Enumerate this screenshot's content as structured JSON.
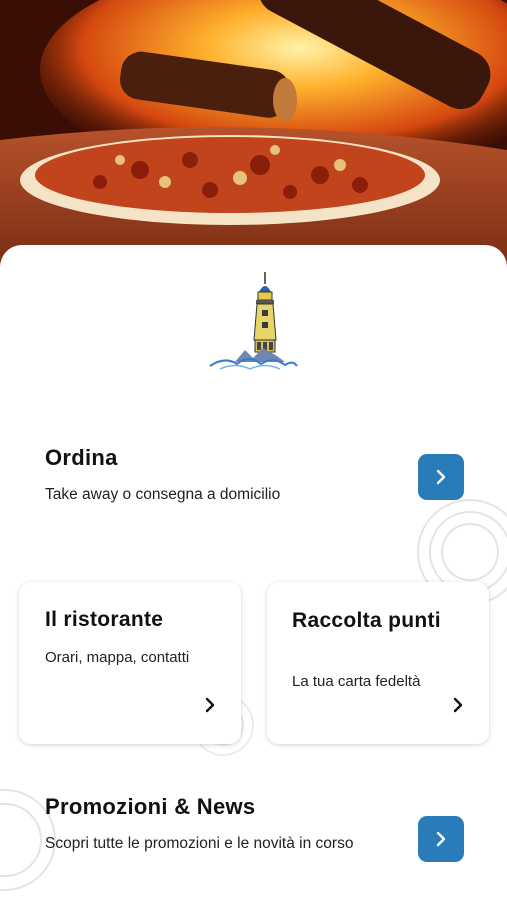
{
  "ordina": {
    "title": "Ordina",
    "subtitle": "Take away o consegna a domicilio"
  },
  "cards": [
    {
      "title": "Il ristorante",
      "subtitle": "Orari, mappa, contatti"
    },
    {
      "title": "Raccolta punti",
      "subtitle": "La tua carta fedeltà"
    }
  ],
  "promo": {
    "title": "Promozioni & News",
    "subtitle": "Scopri tutte le promozioni e le novità in corso"
  },
  "colors": {
    "accent": "#2a7bb9",
    "text": "#111111",
    "background": "#ffffff"
  },
  "icons": {
    "arrow": "chevron-right-icon",
    "logo": "lighthouse-logo"
  }
}
